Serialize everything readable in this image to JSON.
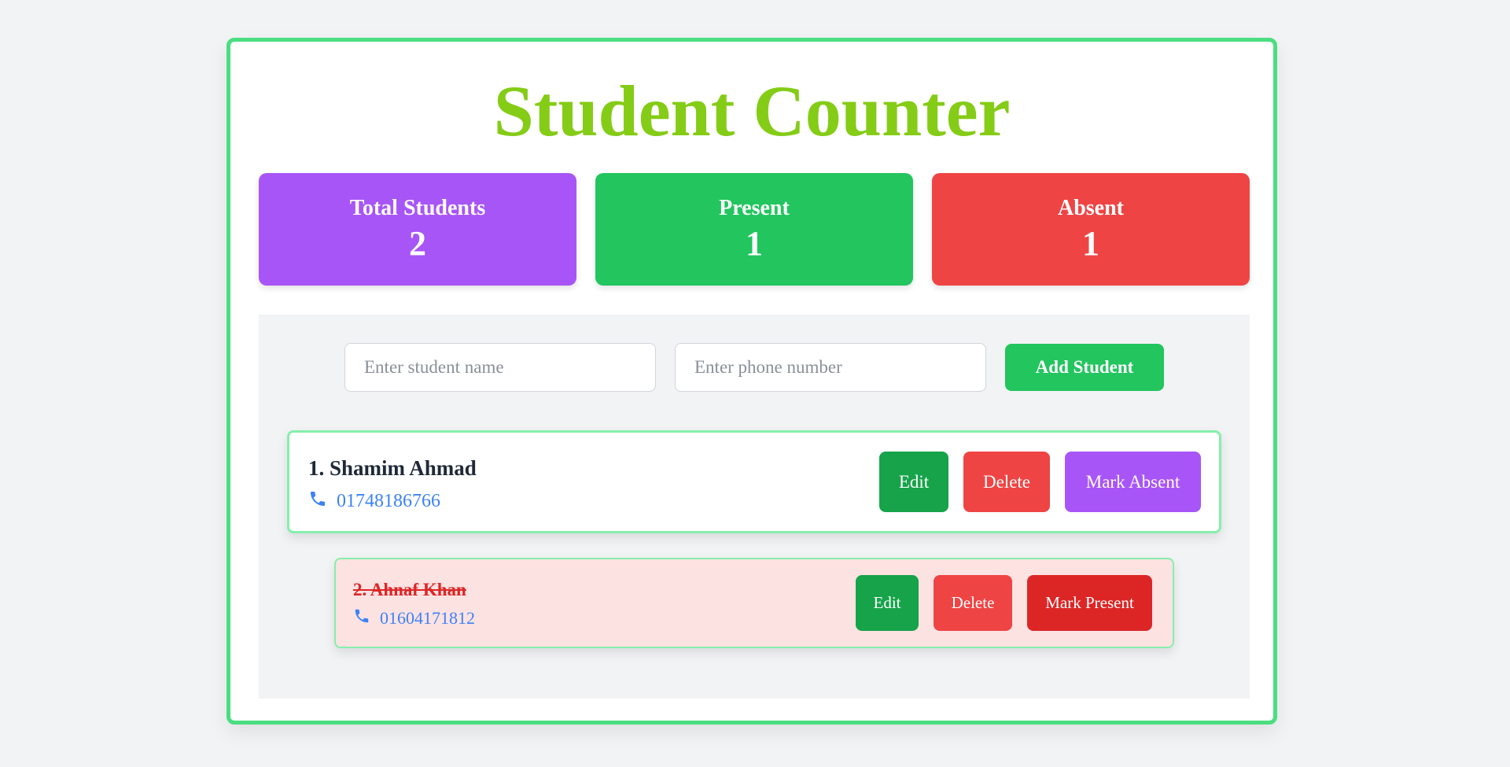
{
  "app": {
    "title": "Student Counter"
  },
  "stats": {
    "total": {
      "label": "Total Students",
      "value": "2",
      "color": "#a855f7"
    },
    "present": {
      "label": "Present",
      "value": "1",
      "color": "#22c55e"
    },
    "absent": {
      "label": "Absent",
      "value": "1",
      "color": "#ef4444"
    }
  },
  "form": {
    "name_input": {
      "placeholder": "Enter student name",
      "value": ""
    },
    "phone_input": {
      "placeholder": "Enter phone number",
      "value": ""
    },
    "add_label": "Add Student"
  },
  "students": [
    {
      "name": "1. Shamim Ahmad",
      "phone": "01748186766",
      "status": "present",
      "edit_label": "Edit",
      "delete_label": "Delete",
      "toggle_label": "Mark Absent"
    },
    {
      "name": "2. Ahnaf Khan",
      "phone": "01604171812",
      "status": "absent",
      "edit_label": "Edit",
      "delete_label": "Delete",
      "toggle_label": "Mark Present"
    }
  ],
  "colors": {
    "accent_title": "#84cc16",
    "card_border": "#4ade80",
    "phone_text": "#3b82f6",
    "absent_row_bg": "#fde2e2"
  },
  "icons": {
    "phone": "phone-icon"
  }
}
